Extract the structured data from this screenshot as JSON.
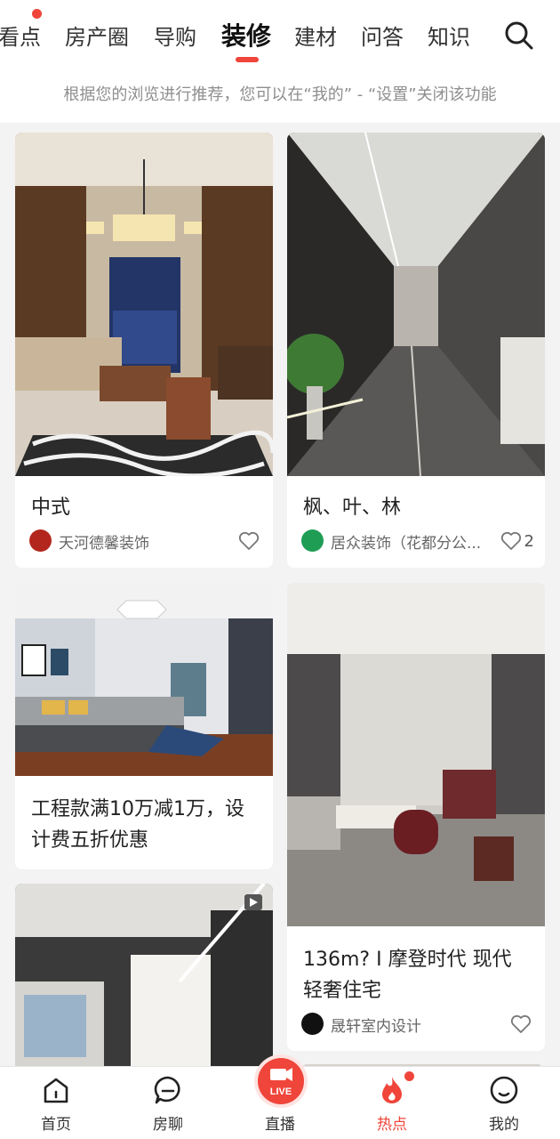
{
  "top_nav": {
    "tabs": [
      "看点",
      "房产圈",
      "导购",
      "装修",
      "建材",
      "问答",
      "知识"
    ],
    "active_tab": "装修"
  },
  "hint": "根据您的浏览进行推荐，您可以在“我的” - “设置”关闭该功能",
  "feed": {
    "cards": [
      {
        "title": "中式",
        "author": "天河德馨装饰",
        "likes": ""
      },
      {
        "title": "枫、叶、林",
        "author": "居众装饰（花都分公...",
        "likes": "2"
      },
      {
        "title": "工程款满10万减1万，设计费五折优惠"
      },
      {
        "title": "136m? I 摩登时代 现代轻奢住宅",
        "author": "晟轩室内设计",
        "likes": ""
      }
    ]
  },
  "bottom_nav": {
    "items": [
      "首页",
      "房聊",
      "直播",
      "热点",
      "我的"
    ],
    "active": "热点",
    "live_badge": "LIVE"
  },
  "colors": {
    "accent": "#f0453a",
    "background": "#f3f3f3"
  }
}
